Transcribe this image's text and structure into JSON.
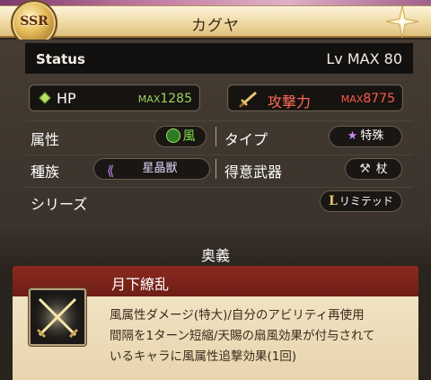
{
  "header": {
    "rarity": "SSR",
    "name": "カグヤ"
  },
  "status": {
    "label": "Status",
    "level": "Lv MAX 80",
    "hp": {
      "name": "HP",
      "max_prefix": "MAX",
      "value": "1285"
    },
    "atk": {
      "name": "攻撃力",
      "max_prefix": "MAX",
      "value": "8775"
    }
  },
  "attributes": {
    "element_label": "属性",
    "element_value": "風",
    "type_label": "タイプ",
    "type_value": "特殊",
    "race_label": "種族",
    "race_value": "星晶獣",
    "weapon_label": "得意武器",
    "weapon_value": "杖",
    "series_label": "シリーズ",
    "series_value": "リミテッド",
    "series_letter": "L"
  },
  "ougi": {
    "section_title": "奥義",
    "name": "月下繚乱",
    "description_lines": [
      "風属性ダメージ(特大)/自分のアビリティ再使用",
      "間隔を1ターン短縮/天賜の扇風効果が付与されて",
      "いるキャラに風属性追撃効果(1回)"
    ]
  },
  "colors": {
    "hp_max": "#9cd45a",
    "atk_max": "#ff5a4a",
    "wind": "#6ccf3c",
    "type_purple": "#b46ae0",
    "ougi_header": "#8a2a1e"
  }
}
